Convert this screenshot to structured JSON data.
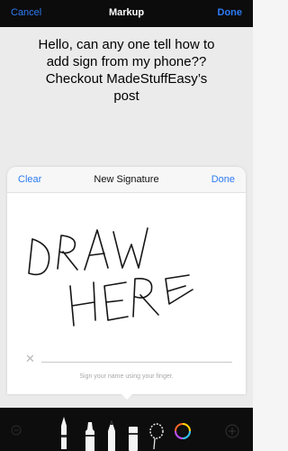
{
  "nav": {
    "cancel_label": "Cancel",
    "title": "Markup",
    "done_label": "Done"
  },
  "document": {
    "text": "Hello, can any one tell how to\nadd sign from my phone??\nCheckout MadeStuffEasy’s\npost"
  },
  "signature_sheet": {
    "clear_label": "Clear",
    "title": "New Signature",
    "done_label": "Done",
    "clear_x_glyph": "✕",
    "hint": "Sign your name using your finger.",
    "handwriting": [
      "DRAW",
      "HERE"
    ]
  },
  "toolbar": {
    "tools": [
      {
        "icon": "undo-icon"
      },
      {
        "icon": "pen-icon"
      },
      {
        "icon": "marker-icon"
      },
      {
        "icon": "pencil-icon"
      },
      {
        "icon": "eraser-icon"
      },
      {
        "icon": "lasso-icon"
      },
      {
        "icon": "color-picker-icon"
      },
      {
        "icon": "add-icon"
      }
    ]
  },
  "colors": {
    "accent": "#2d7bf4",
    "nav_background": "#0c0c0c",
    "toolbar_background": "#0d0d0d",
    "sheet_background": "#ffffff"
  }
}
